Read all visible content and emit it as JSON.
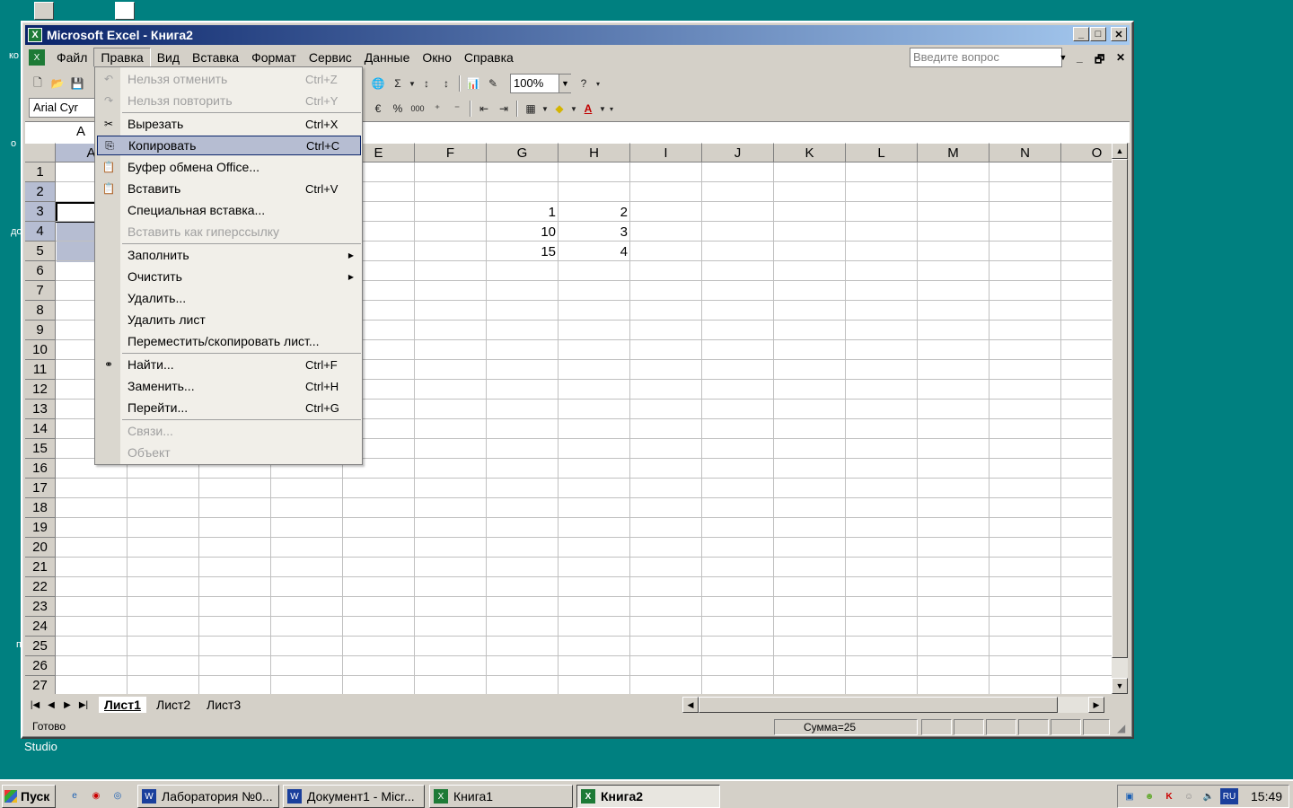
{
  "desktop": {
    "label_studio": "Studio",
    "edge_labels": [
      "ко",
      "о",
      "до",
      "п"
    ]
  },
  "window": {
    "title": "Microsoft Excel - Книга2",
    "minimize": "_",
    "maximize": "□",
    "close": "✕"
  },
  "menubar": {
    "items": [
      "Файл",
      "Правка",
      "Вид",
      "Вставка",
      "Формат",
      "Сервис",
      "Данные",
      "Окно",
      "Справка"
    ],
    "active": "Правка",
    "ask_placeholder": "Введите вопрос"
  },
  "toolbar": {
    "font_name": "Arial Cyr",
    "zoom": "100%",
    "sigma": "Σ",
    "percent": "%",
    "thousands": "000"
  },
  "formula_bar": {
    "name_box": "A"
  },
  "columns": [
    "A",
    "E",
    "F",
    "G",
    "H",
    "I",
    "J",
    "K",
    "L",
    "M",
    "N",
    "O"
  ],
  "rows": [
    "1",
    "2",
    "3",
    "4",
    "5",
    "6",
    "7",
    "8",
    "9",
    "10",
    "11",
    "12",
    "13",
    "14",
    "15",
    "16",
    "17",
    "18",
    "19",
    "20",
    "21",
    "22",
    "23",
    "24",
    "25",
    "26",
    "27"
  ],
  "cells": {
    "G2": "1",
    "H2": "2",
    "G3": "10",
    "H3": "3",
    "G4": "15",
    "H4": "4"
  },
  "edit_menu": [
    {
      "label": "Нельзя отменить",
      "shortcut": "Ctrl+Z",
      "disabled": true,
      "icon": "undo-icon"
    },
    {
      "label": "Нельзя повторить",
      "shortcut": "Ctrl+Y",
      "disabled": true,
      "icon": "redo-icon"
    },
    {
      "label": "Вырезать",
      "shortcut": "Ctrl+X",
      "icon": "scissors-icon"
    },
    {
      "label": "Копировать",
      "shortcut": "Ctrl+C",
      "icon": "copy-icon",
      "highlighted": true
    },
    {
      "label": "Буфер обмена Office...",
      "shortcut": "",
      "icon": "clipboard-icon"
    },
    {
      "label": "Вставить",
      "shortcut": "Ctrl+V",
      "icon": "paste-icon"
    },
    {
      "label": "Специальная вставка...",
      "shortcut": ""
    },
    {
      "label": "Вставить как гиперссылку",
      "shortcut": "",
      "disabled": true
    },
    {
      "label": "Заполнить",
      "shortcut": "",
      "submenu": true
    },
    {
      "label": "Очистить",
      "shortcut": "",
      "submenu": true
    },
    {
      "label": "Удалить...",
      "shortcut": ""
    },
    {
      "label": "Удалить лист",
      "shortcut": ""
    },
    {
      "label": "Переместить/скопировать лист...",
      "shortcut": ""
    },
    {
      "label": "Найти...",
      "shortcut": "Ctrl+F",
      "icon": "binoculars-icon"
    },
    {
      "label": "Заменить...",
      "shortcut": "Ctrl+H"
    },
    {
      "label": "Перейти...",
      "shortcut": "Ctrl+G"
    },
    {
      "label": "Связи...",
      "shortcut": "",
      "disabled": true
    },
    {
      "label": "Объект",
      "shortcut": "",
      "disabled": true
    }
  ],
  "sheet_tabs": [
    "Лист1",
    "Лист2",
    "Лист3"
  ],
  "active_sheet": "Лист1",
  "status": {
    "ready": "Готово",
    "sum": "Сумма=25"
  },
  "taskbar": {
    "start": "Пуск",
    "buttons": [
      "Лаборатория №0...",
      "Документ1 - Micr...",
      "Книга1",
      "Книга2"
    ],
    "active": "Книга2",
    "language": "RU",
    "clock": "15:49"
  },
  "colors": {
    "desktop": "#008080",
    "title_start": "#0a246a",
    "selection": "#b6bdd2",
    "face": "#d4d0c8"
  }
}
